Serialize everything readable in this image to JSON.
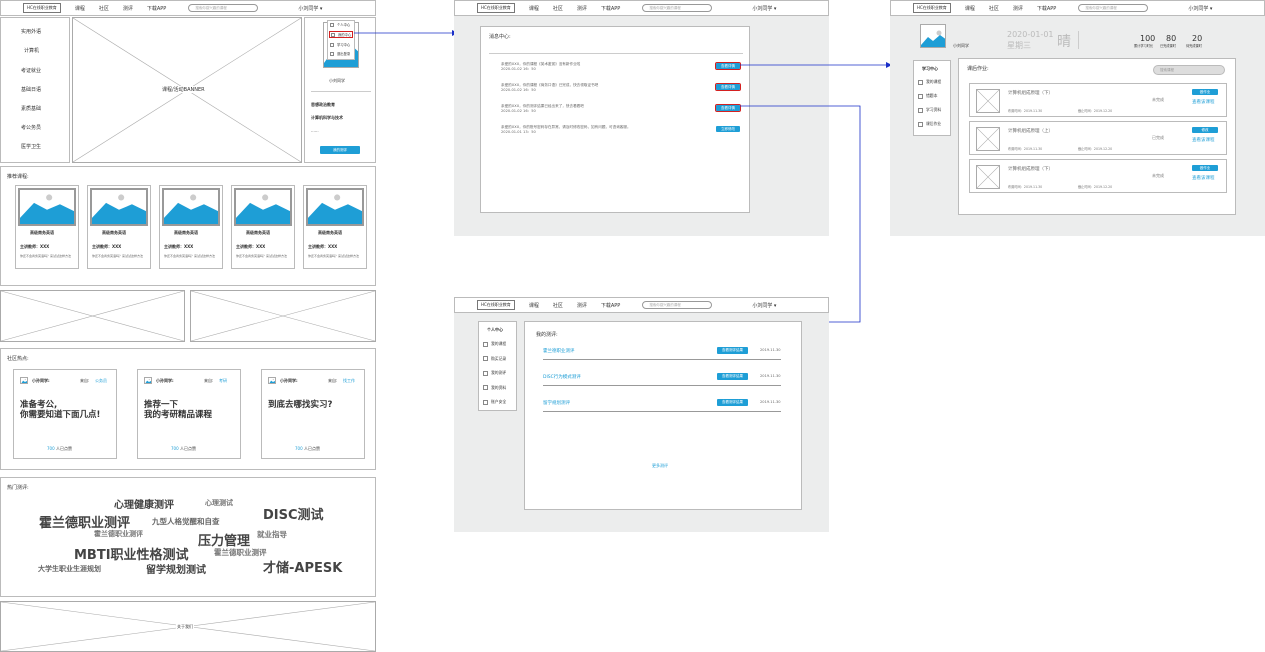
{
  "nav": {
    "logo": "HC在线职业教育",
    "links": [
      "课程",
      "社区",
      "测评",
      "下载APP"
    ],
    "search_placeholder": "搜索你感兴趣的课程",
    "user": "小刘同学 ▾"
  },
  "home": {
    "categories": [
      "实用外语",
      "计算机",
      "考证就业",
      "基础日语",
      "素质基础",
      "考公务员",
      "医学卫生"
    ],
    "banner": "课程/活动BANNER",
    "user_menu": [
      "个人中心",
      "我的中心",
      "学习中心",
      "退出登录"
    ],
    "user_name": "小刘同学",
    "profile_lines": [
      "思想政治教育",
      "计算机科学与技术",
      "......"
    ],
    "profile_button": "我的测评",
    "recommended_title": "推荐课程:",
    "courses": [
      {
        "name": "高级商务英语",
        "teacher": "主讲教师：XXX",
        "desc": "你还不会商务英语吗？来试试这样方法"
      },
      {
        "name": "高级商务英语",
        "teacher": "主讲教师：XXX",
        "desc": "你还不会商务英语吗？来试试这样方法"
      },
      {
        "name": "高级商务英语",
        "teacher": "主讲教师：XXX",
        "desc": "你还不会商务英语吗？来试试这样方法"
      },
      {
        "name": "高级商务英语",
        "teacher": "主讲教师：XXX",
        "desc": "你还不会商务英语吗？来试试这样方法"
      },
      {
        "name": "高级商务英语",
        "teacher": "主讲教师：XXX",
        "desc": "你还不会商务英语吗？来试试这样方法"
      }
    ],
    "community_title": "社区热点:",
    "posts": [
      {
        "author": "小孙同学:",
        "from_label": "来自:",
        "from": "公务员",
        "title": "准备考公,\n你需要知道下面几点!",
        "likes_num": "700",
        "likes_label": "人已点赞"
      },
      {
        "author": "小孙同学:",
        "from_label": "来自:",
        "from": "考研",
        "title": "推荐一下\n我的考研精品课程",
        "likes_num": "700",
        "likes_label": "人已点赞"
      },
      {
        "author": "小孙同学:",
        "from_label": "来自:",
        "from": "找工作",
        "title": "到底去哪找实习?",
        "likes_num": "700",
        "likes_label": "人已点赞"
      }
    ],
    "hot_title": "热门测评:",
    "hot_words": [
      "心理健康测评",
      "心理测试",
      "DISC测试",
      "霍兰德职业测评",
      "九型人格觉醒和自查",
      "霍兰德职业测评",
      "压力管理",
      "就业指导",
      "MBTI职业性格测试",
      "霍兰德职业测评",
      "大学生职业生涯规划",
      "留学规划测试",
      "才储-APESK"
    ],
    "footer": "关于我们"
  },
  "messages": {
    "title": "消息中心:",
    "items": [
      {
        "text": "亲爱的XXX，你的课程《英术鉴赏》没有新作业啦",
        "time": "2020-01-02  16：50",
        "button": "查看详情"
      },
      {
        "text": "亲爱的XXX，你的课程《商务口语》已完成，快去领取证书吧",
        "time": "2020-01-02  16：50",
        "button": "查看详情"
      },
      {
        "text": "亲爱的XXX，你的测评结果已经出来了，快去看看吧",
        "time": "2020-01-02  16：50",
        "button": "查看详情"
      },
      {
        "text": "亲爱的XXX，你的账号密码存在异常，请及时修改密码，如有问题，可咨询客服。",
        "time": "2020-01-01  13：50",
        "button": "立即修改"
      }
    ]
  },
  "study": {
    "user_name": "小刘同学",
    "date": "2020-01-01",
    "weekday": "星期三",
    "weather": "晴",
    "stats": [
      {
        "num": "100",
        "label": "累计学习时长"
      },
      {
        "num": "80",
        "label": "已完成课时"
      },
      {
        "num": "20",
        "label": "待完成课时"
      }
    ],
    "side_title": "学习中心",
    "side_items": [
      "我的课程",
      "错题本",
      "学习资料",
      "课后作业"
    ],
    "section_title": "课后作业:",
    "search_placeholder": "搜索课程",
    "homeworks": [
      {
        "title": "计算机组成原理（下）",
        "release": "布置时间：2019.11.30",
        "deadline": "截止时间：2019.12.20",
        "status": "未完成",
        "button": "做作业",
        "link": "查看该课程"
      },
      {
        "title": "计算机组成原理（上）",
        "release": "布置时间：2019.11.30",
        "deadline": "截止时间：2019.12.20",
        "status": "已完成",
        "button": "修改",
        "link": "查看该课程"
      },
      {
        "title": "计算机组成原理（下）",
        "release": "布置时间：2019.11.30",
        "deadline": "截止时间：2019.12.20",
        "status": "未完成",
        "button": "做作业",
        "link": "查看该课程"
      }
    ]
  },
  "tests": {
    "side_title": "个人中心",
    "side_items": [
      "我的课程",
      "购买记录",
      "我的测评",
      "我的资料",
      "账户安全"
    ],
    "title": "我的测评:",
    "items": [
      {
        "name": "霍兰德职业测评",
        "button": "查看测评结果",
        "date": "2019.11.30"
      },
      {
        "name": "DISC行为模式测评",
        "button": "查看测评结果",
        "date": "2019.11.30"
      },
      {
        "name": "留学规划测评",
        "button": "查看测评结果",
        "date": "2019.11.30"
      }
    ],
    "more": "更多测评"
  },
  "colors": {
    "accent": "#1e9ed6",
    "arrow": "#1a2fc8",
    "highlight": "#d42020"
  }
}
